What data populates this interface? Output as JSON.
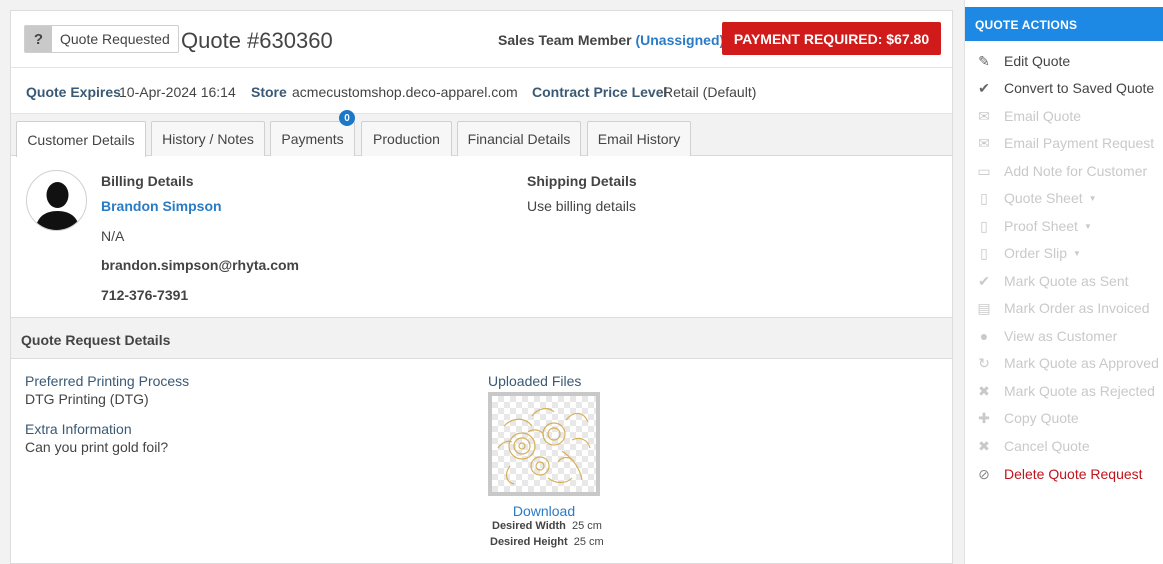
{
  "header": {
    "status_symbol": "?",
    "status_label": "Quote Requested",
    "quote_number": "Quote #630360",
    "sales_label": "Sales Team Member",
    "sales_value": "(Unassigned)",
    "payment_button": "PAYMENT REQUIRED: $67.80"
  },
  "meta": {
    "expires_label": "Quote Expires",
    "expires_value": "10-Apr-2024 16:14",
    "store_label": "Store",
    "store_value": "acmecustomshop.deco-apparel.com",
    "price_label": "Contract Price Level",
    "price_value": "Retail (Default)"
  },
  "tabs": [
    {
      "label": "Customer Details"
    },
    {
      "label": "History / Notes"
    },
    {
      "label": "Payments",
      "badge": "0"
    },
    {
      "label": "Production"
    },
    {
      "label": "Financial Details"
    },
    {
      "label": "Email History"
    }
  ],
  "billing": {
    "heading": "Billing Details",
    "name": "Brandon Simpson",
    "company": "N/A",
    "email": "brandon.simpson@rhyta.com",
    "phone": "712-376-7391"
  },
  "shipping": {
    "heading": "Shipping Details",
    "value": "Use billing details"
  },
  "quote_request": {
    "heading": "Quote Request Details",
    "process_label": "Preferred Printing Process",
    "process_value": "DTG Printing (DTG)",
    "extra_label": "Extra Information",
    "extra_value": "Can you print gold foil?",
    "files_label": "Uploaded Files",
    "download_label": "Download",
    "width_label": "Desired Width",
    "width_value": "25 cm",
    "height_label": "Desired Height",
    "height_value": "25 cm"
  },
  "actions": {
    "heading": "QUOTE ACTIONS",
    "items": [
      {
        "label": "Edit Quote",
        "icon": "pencil-icon"
      },
      {
        "label": "Convert to Saved Quote",
        "icon": "check-icon"
      },
      {
        "label": "Email Quote",
        "icon": "envelope-icon"
      },
      {
        "label": "Email Payment Request",
        "icon": "envelope-icon"
      },
      {
        "label": "Add Note for Customer",
        "icon": "comment-icon"
      },
      {
        "label": "Quote Sheet",
        "icon": "file-icon"
      },
      {
        "label": "Proof Sheet",
        "icon": "file-icon"
      },
      {
        "label": "Order Slip",
        "icon": "file-icon"
      },
      {
        "label": "Mark Quote as Sent",
        "icon": "check-icon"
      },
      {
        "label": "Mark Order as Invoiced",
        "icon": "invoice-icon"
      },
      {
        "label": "View as Customer",
        "icon": "user-icon"
      },
      {
        "label": "Mark Quote as Approved",
        "icon": "redo-icon"
      },
      {
        "label": "Mark Quote as Rejected",
        "icon": "x-icon"
      },
      {
        "label": "Copy Quote",
        "icon": "plus-icon"
      },
      {
        "label": "Cancel Quote",
        "icon": "x-icon"
      },
      {
        "label": "Delete Quote Request",
        "icon": "ban-icon"
      }
    ]
  },
  "colors": {
    "accent": "#1e88e5",
    "link": "#2a7bc5",
    "danger": "#d11a1a"
  }
}
